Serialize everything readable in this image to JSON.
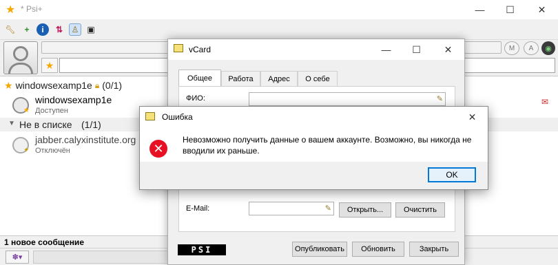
{
  "psi": {
    "title": "* Psi+",
    "window_controls": {
      "minimize": "—",
      "maximize": "☐",
      "close": "✕"
    },
    "toolbar_icons": [
      "wrench-icon",
      "add-contact-icon",
      "info-icon",
      "sort-icon",
      "user-icon",
      "terminal-icon"
    ],
    "roster": {
      "account": {
        "name": "windowsexamp1e",
        "count": "(0/1)"
      },
      "contacts": [
        {
          "name": "windowsexamp1e",
          "status": "Доступен"
        }
      ],
      "group_not_in_list": {
        "label": "Не в списке",
        "count": "(1/1)"
      },
      "offline_contacts": [
        {
          "name": "jabber.calyxinstitute.org",
          "status": "Отключён"
        }
      ]
    },
    "statusbar": "1 новое сообщение"
  },
  "vcard": {
    "title": "vCard",
    "window_controls": {
      "minimize": "—",
      "maximize": "☐",
      "close": "✕"
    },
    "tabs": [
      "Общее",
      "Работа",
      "Адрес",
      "О себе"
    ],
    "active_tab": "Общее",
    "fields": {
      "fio_label": "ФИО:",
      "fio_value": "",
      "email_label": "E-Mail:",
      "email_value": ""
    },
    "buttons": {
      "open": "Открыть...",
      "clear": "Очистить",
      "publish": "Опубликовать",
      "refresh": "Обновить",
      "close": "Закрыть"
    },
    "logo": "PSI"
  },
  "error": {
    "title": "Ошибка",
    "message": "Невозможно получить данные о вашем аккаунте. Возможно, вы никогда не вводили их раньше.",
    "ok": "OK",
    "close": "✕"
  }
}
